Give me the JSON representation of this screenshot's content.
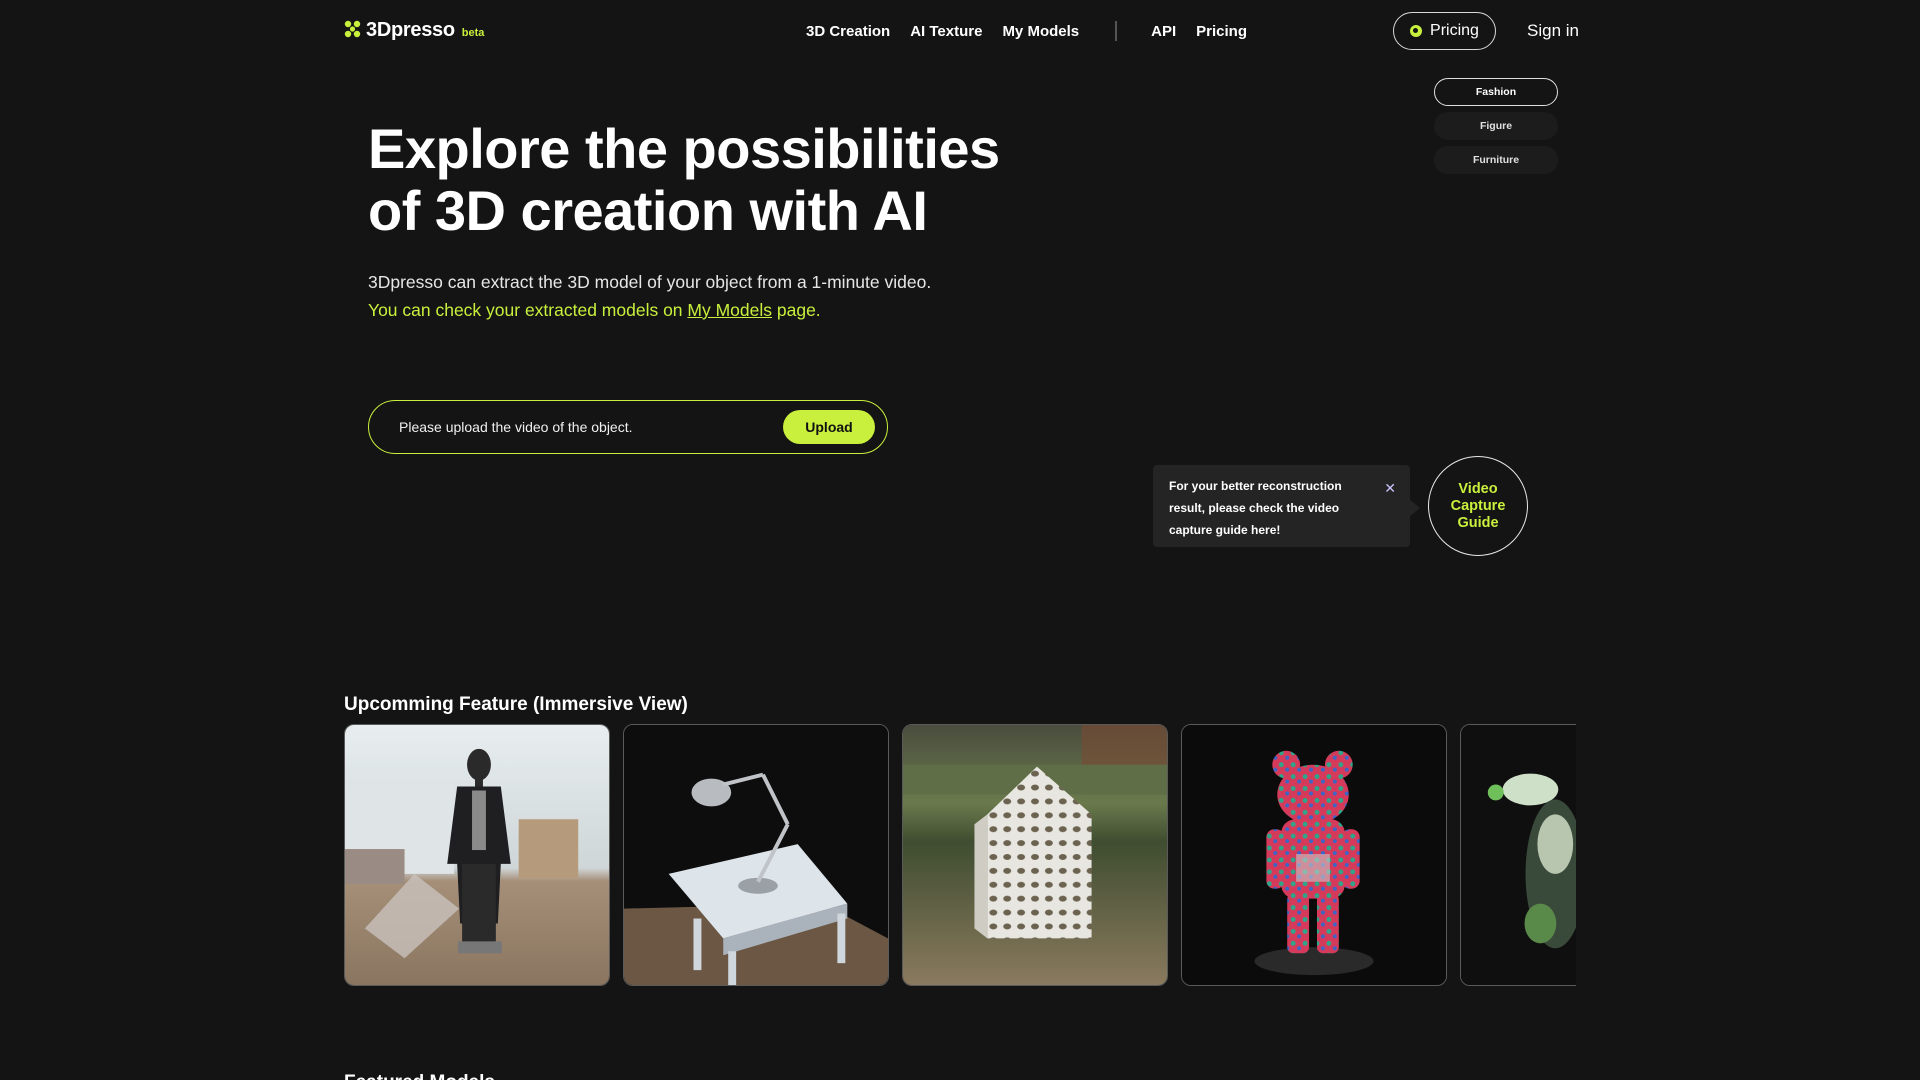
{
  "header": {
    "logo_text": "3Dpresso",
    "logo_badge": "beta",
    "nav": [
      {
        "label": "3D Creation"
      },
      {
        "label": "AI Texture"
      },
      {
        "label": "My Models"
      },
      {
        "label": "API"
      },
      {
        "label": "Pricing"
      }
    ],
    "pricing_button": "Pricing",
    "signin": "Sign in"
  },
  "categories": [
    {
      "label": "Fashion",
      "active": true
    },
    {
      "label": "Figure",
      "active": false
    },
    {
      "label": "Furniture",
      "active": false
    }
  ],
  "hero": {
    "title_line1": "Explore the possibilities",
    "title_line2": "of 3D creation with AI",
    "subtitle": "3Dpresso can extract the 3D model of your object from a 1-minute video.",
    "accent_pre": "You can check your extracted models on ",
    "accent_link": "My Models",
    "accent_post": " page."
  },
  "upload": {
    "placeholder": "Please upload the video of the object.",
    "button": "Upload"
  },
  "tooltip": {
    "text": "For your better reconstruction result, please check the video capture guide here!",
    "close": "✕"
  },
  "guide": {
    "label": "Video Capture Guide"
  },
  "upcoming": {
    "title": "Upcomming Feature (Immersive View)",
    "cards": [
      {
        "icon": "mannequin-coat-icon"
      },
      {
        "icon": "desk-lamp-on-table-icon"
      },
      {
        "icon": "lattice-house-on-grass-icon"
      },
      {
        "icon": "patterned-bear-figure-icon"
      },
      {
        "icon": "toy-figure-icon"
      }
    ]
  },
  "featured": {
    "title": "Featured Models"
  },
  "colors": {
    "accent": "#c8f03c",
    "background": "#141414",
    "tooltip_bg": "#242424"
  }
}
